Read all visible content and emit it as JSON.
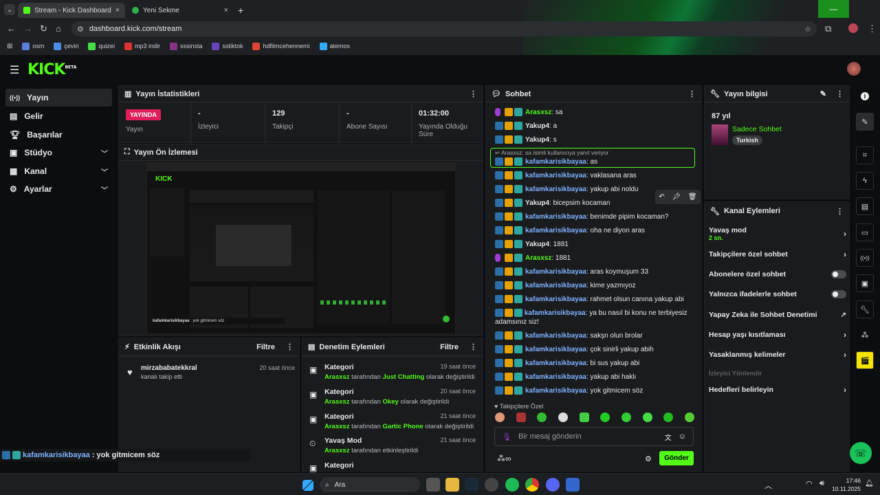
{
  "browser": {
    "tabs": [
      {
        "title": "Stream - Kick Dashboard",
        "active": true
      },
      {
        "title": "Yeni Sekme",
        "active": false
      }
    ],
    "url": "dashboard.kick.com/stream",
    "bookmarks": [
      "osm",
      "çeviri",
      "quizei",
      "mp3 indir",
      "sssinsta",
      "sstiktok",
      "hdfilmcehennemi",
      "atemos"
    ]
  },
  "app": {
    "logo": "KICK",
    "beta": "BETA"
  },
  "sidebar": {
    "items": [
      {
        "label": "Yayın",
        "icon": "broadcast-icon",
        "active": true,
        "expand": false
      },
      {
        "label": "Gelir",
        "icon": "money-icon",
        "active": false,
        "expand": false
      },
      {
        "label": "Başarılar",
        "icon": "trophy-icon",
        "active": false,
        "expand": false
      },
      {
        "label": "Stüdyo",
        "icon": "studio-icon",
        "active": false,
        "expand": true
      },
      {
        "label": "Kanal",
        "icon": "channel-icon",
        "active": false,
        "expand": true
      },
      {
        "label": "Ayarlar",
        "icon": "gear-icon",
        "active": false,
        "expand": true
      }
    ]
  },
  "stats": {
    "title": "Yayın İstatistikleri",
    "live_badge": "YAYINDA",
    "live_label": "Yayın",
    "items": [
      {
        "value": "-",
        "label": "İzleyici"
      },
      {
        "value": "129",
        "label": "Takipçi"
      },
      {
        "value": "-",
        "label": "Abone Sayısı"
      },
      {
        "value": "01:32:00",
        "label": "Yayında Olduğu Süre"
      }
    ]
  },
  "preview": {
    "title": "Yayın Ön İzlemesi",
    "overlay_user": "kafamkarisikbayaa",
    "overlay_msg": "yok gitmicem söz"
  },
  "activity": {
    "title": "Etkinlik Akışı",
    "filter": "Filtre",
    "events": [
      {
        "user": "mirzababatekkral",
        "text": "kanalı takip etti",
        "time": "20 saat önce"
      }
    ]
  },
  "moderation": {
    "title": "Denetim Eylemleri",
    "filter": "Filtre",
    "items": [
      {
        "title": "Kategori",
        "time": "19 saat önce",
        "user": "Arasxsz",
        "mid": "tarafından",
        "value": "Just Chatting",
        "end": "olarak değiştirildi"
      },
      {
        "title": "Kategori",
        "time": "20 saat önce",
        "user": "Arasxsz",
        "mid": "tarafından",
        "value": "Okey",
        "end": "olarak değiştirildi"
      },
      {
        "title": "Kategori",
        "time": "21 saat önce",
        "user": "Arasxsz",
        "mid": "tarafından",
        "value": "Gartic Phone",
        "end": "olarak değiştirildi"
      },
      {
        "title": "Yavaş Mod",
        "time": "21 saat önce",
        "user": "Arasxsz",
        "mid": "tarafından etkinleştirildi",
        "value": "",
        "end": ""
      },
      {
        "title": "Kategori",
        "time": "",
        "user": "",
        "mid": "",
        "value": "",
        "end": ""
      }
    ]
  },
  "chat": {
    "title": "Sohbet",
    "reply_note": "Arasxsz: sa isimli kullanıcıya yanıt veriyor",
    "messages": [
      {
        "user": "Arasxsz",
        "text": "sa",
        "color": "g",
        "mic": true
      },
      {
        "user": "Yakup4",
        "text": "a",
        "color": "w",
        "mic": false
      },
      {
        "user": "Yakup4",
        "text": "s",
        "color": "w",
        "mic": false
      },
      {
        "user": "kafamkarisikbayaa",
        "text": "as",
        "color": "b",
        "mic": false
      },
      {
        "user": "kafamkarisikbayaa",
        "text": "vaklasana aras",
        "color": "b",
        "mic": false
      },
      {
        "user": "kafamkarisikbayaa",
        "text": "yakup abi noldu",
        "color": "b",
        "mic": false
      },
      {
        "user": "Yakup4",
        "text": "bicepsim kocaman",
        "color": "w",
        "mic": false
      },
      {
        "user": "kafamkarisikbayaa",
        "text": "benimde pipim kocaman?",
        "color": "b",
        "mic": false
      },
      {
        "user": "kafamkarisikbayaa",
        "text": "oha ne diyon aras",
        "color": "b",
        "mic": false
      },
      {
        "user": "Yakup4",
        "text": "1881",
        "color": "w",
        "mic": false
      },
      {
        "user": "Arasxsz",
        "text": "1881",
        "color": "g",
        "mic": true
      },
      {
        "user": "kafamkarisikbayaa",
        "text": "aras koymuşum 33",
        "color": "b",
        "mic": false
      },
      {
        "user": "kafamkarisikbayaa",
        "text": "kime yazmıyoz",
        "color": "b",
        "mic": false
      },
      {
        "user": "kafamkarisikbayaa",
        "text": "rahmet olsun canına yakup abi",
        "color": "b",
        "mic": false
      },
      {
        "user": "kafamkarisikbayaa",
        "text": "ya bu nasıl bi konu ne terbiyesiz adamsınız siz!",
        "color": "b",
        "mic": false
      },
      {
        "user": "kafamkarisikbayaa",
        "text": "sakşn olun brolar",
        "color": "b",
        "mic": false
      },
      {
        "user": "kafamkarisikbayaa",
        "text": "çok sinirli yakup abih",
        "color": "b",
        "mic": false
      },
      {
        "user": "kafamkarisikbayaa",
        "text": "bi sus yakup abi",
        "color": "b",
        "mic": false
      },
      {
        "user": "kafamkarisikbayaa",
        "text": "yakup abi haklı",
        "color": "b",
        "mic": false
      },
      {
        "user": "kafamkarisikbayaa",
        "text": "yok gitmicem söz",
        "color": "b",
        "mic": false
      }
    ],
    "followers_only": "Takipçilere Özel",
    "input_placeholder": "Bir mesaj gönderin",
    "send_label": "Gönder"
  },
  "stream_info": {
    "title": "Yayın bilgisi",
    "stream_title": "87 yıl",
    "category": "Sadece Sohbet",
    "language": "Turkish"
  },
  "channel_actions": {
    "title": "Kanal Eylemleri",
    "slow_mode": "Yavaş mod",
    "slow_mode_value": "2 sn.",
    "followers_chat": "Takipçilere özel sohbet",
    "subs_chat": "Abonelere özel sohbet",
    "emote_chat": "Yalnızca ifadelerle sohbet",
    "ai_mod": "Yapay Zeka ile Sohbet Denetimi",
    "age_limit": "Hesap yaşı kısıtlaması",
    "banned_words": "Yasaklanmış kelimeler",
    "viewer_redirect": "İzleyici Yönlendir",
    "goals": "Hedefleri belirleyin"
  },
  "taskbar": {
    "search": "Ara",
    "time": "17:46",
    "date": "10.11.2025"
  },
  "colors": {
    "accent": "#53fc18",
    "live": "#e01e5a"
  }
}
